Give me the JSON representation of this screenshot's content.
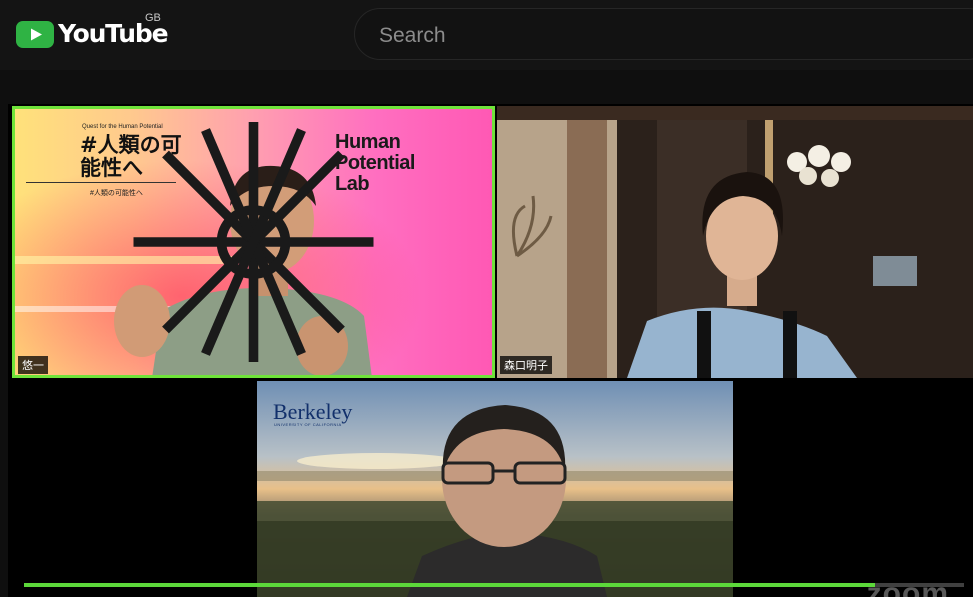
{
  "header": {
    "logo_text": "YouTube",
    "region": "GB",
    "search_placeholder": "Search"
  },
  "video": {
    "participants": [
      {
        "name": "悠一",
        "active_speaker": true
      },
      {
        "name": "森口明子",
        "active_speaker": false
      },
      {
        "name": "",
        "active_speaker": false
      }
    ],
    "background_1": {
      "small_caption": "Quest for the Human Potential",
      "headline": "#人類の可能性へ",
      "hashtag": "#人類の可能性へ",
      "logo_text": "Human Potential Lab"
    },
    "background_3": {
      "logo": "Berkeley",
      "logo_sub": "UNIVERSITY OF CALIFORNIA"
    },
    "watermark": "zoom",
    "progress": 0.905
  },
  "colors": {
    "youtube_red": "#ff0000",
    "active_speaker_border": "#6fe33a",
    "progress_bar": "#5cd83a"
  }
}
